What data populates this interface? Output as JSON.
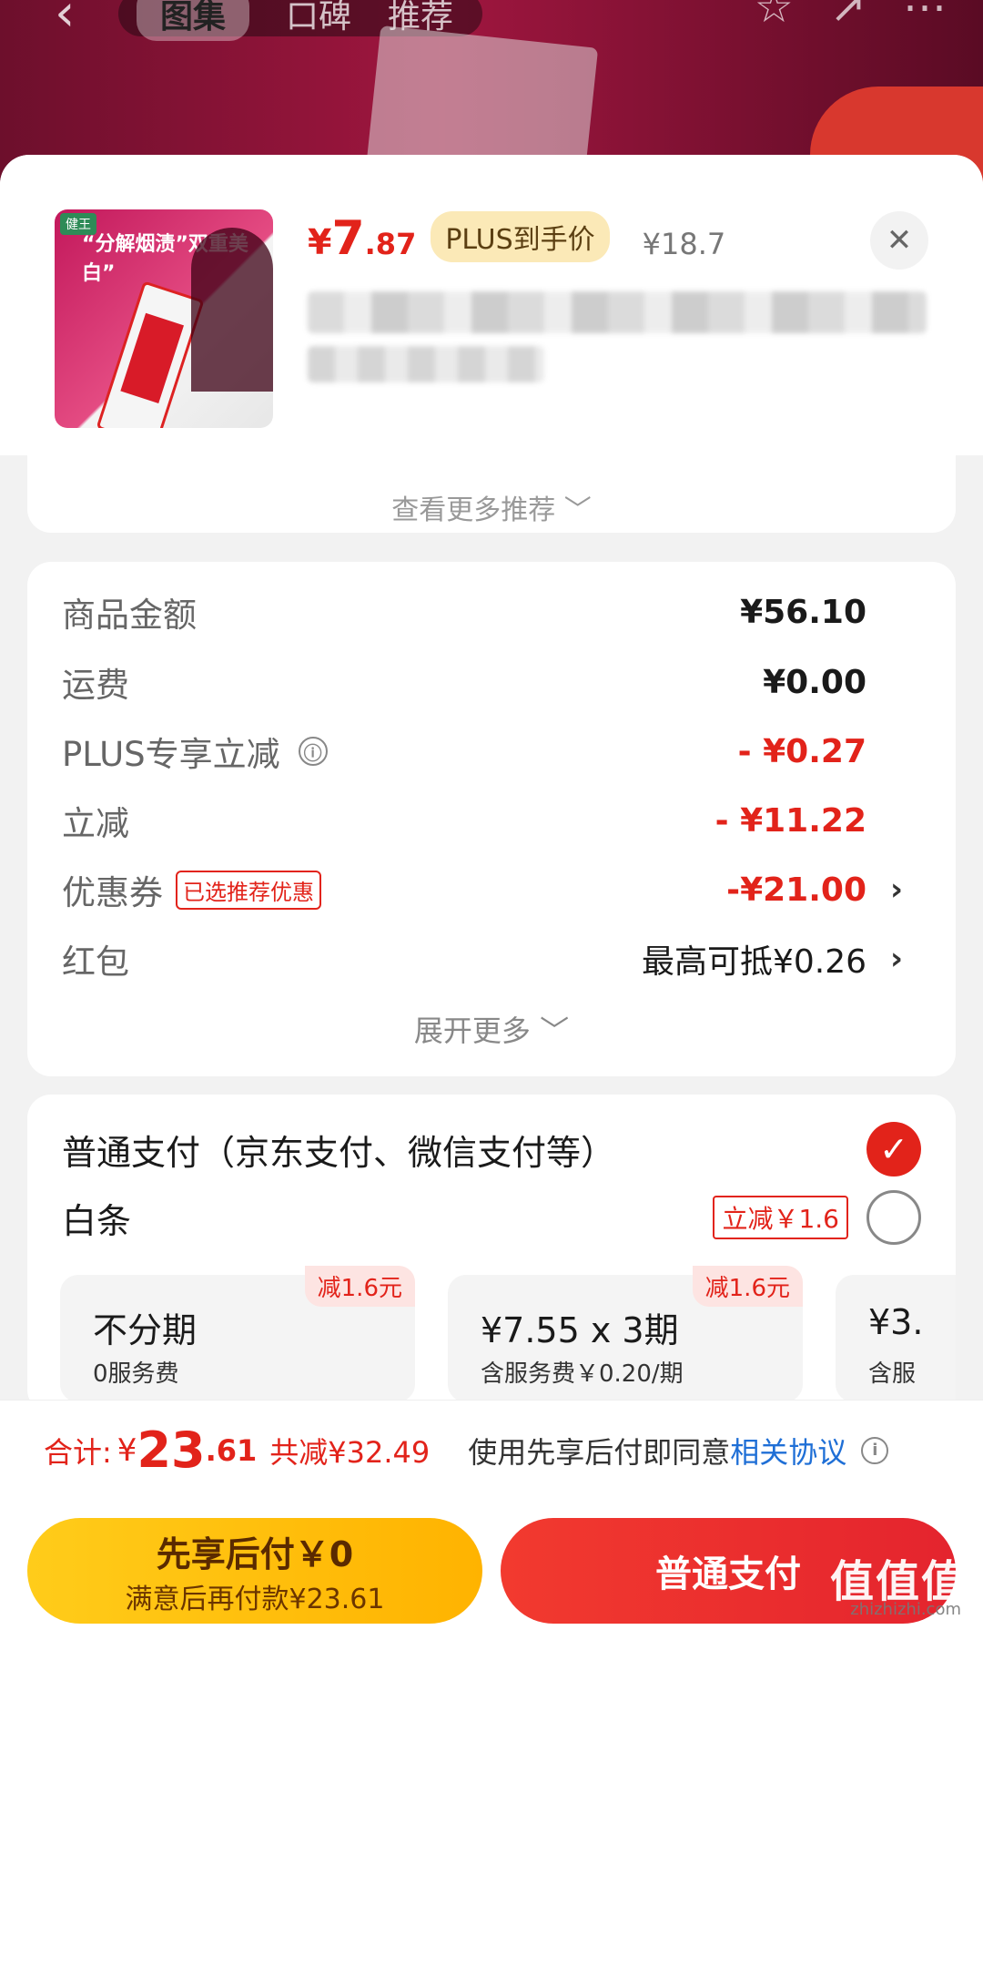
{
  "background": {
    "tabs": [
      "图集",
      "口碑",
      "推荐"
    ],
    "back_icon": "chevron-left-icon"
  },
  "header": {
    "price_yen": "¥",
    "price_int": "7",
    "price_dec": ".87",
    "plus_tag": "PLUS到手价",
    "original_price": "¥18.7",
    "close_label": "✕",
    "thumb_slogan": "“分解烟渍”双重美白”",
    "thumb_tag": "健王"
  },
  "recommend": {
    "more_label": "查看更多推荐 ﹀"
  },
  "summary": {
    "rows": [
      {
        "label": "商品金额",
        "value": "¥56.10"
      },
      {
        "label": "运费",
        "value": "¥0.00"
      },
      {
        "label": "PLUS专享立减",
        "value": "- ¥0.27"
      },
      {
        "label": "立减",
        "value": "- ¥11.22"
      },
      {
        "label": "优惠券",
        "tag": "已选推荐优惠",
        "value": "-¥21.00"
      },
      {
        "label": "红包",
        "value": "最高可抵¥0.26"
      }
    ],
    "expand_label": "展开更多 ﹀",
    "info_icon": "ⓘ",
    "arrow": "›"
  },
  "payment": {
    "normal_title": "普通支付（京东支付、微信支付等）",
    "baitiao_title": "白条",
    "baitiao_tag": "立减￥1.6",
    "plans": [
      {
        "main": "不分期",
        "sub": "0服务费",
        "badge": "减1.6元"
      },
      {
        "main": "¥7.55 x 3期",
        "sub": "含服务费￥0.20/期",
        "badge": "减1.6元"
      },
      {
        "main": "¥3.",
        "sub": "含服"
      }
    ]
  },
  "total": {
    "label": "合计:",
    "yen": "¥",
    "int": "23",
    "dec": ".61",
    "saved": "共减¥32.49",
    "agree_text": "使用先享后付即同意",
    "agree_link": "相关协议"
  },
  "buttons": {
    "pay_later_l1": "先享后付￥0",
    "pay_later_l2": "满意后再付款¥23.61",
    "pay_normal": "普通支付"
  },
  "watermark": {
    "text": "值值值",
    "sub": "zhizhizhi.com"
  },
  "colors": {
    "accent_red": "#e2231a",
    "link_blue": "#1f6fd6",
    "pay_later_yellow": "#ffcc1a"
  }
}
